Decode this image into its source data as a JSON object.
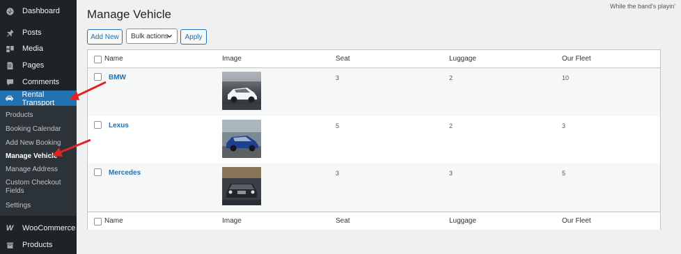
{
  "admin_bar": {
    "text": "While the band's playin'"
  },
  "sidebar": {
    "items": [
      {
        "label": "Dashboard",
        "icon": "dashboard-icon"
      },
      {
        "label": "Posts",
        "icon": "pin-icon"
      },
      {
        "label": "Media",
        "icon": "media-icon"
      },
      {
        "label": "Pages",
        "icon": "pages-icon"
      },
      {
        "label": "Comments",
        "icon": "comments-icon"
      },
      {
        "label": "Rental Transport",
        "icon": "car-icon"
      },
      {
        "label": "WooCommerce",
        "icon": "woocommerce-icon"
      },
      {
        "label": "Products",
        "icon": "products-icon"
      }
    ],
    "submenu": [
      {
        "label": "Products"
      },
      {
        "label": "Booking Calendar"
      },
      {
        "label": "Add New Booking"
      },
      {
        "label": "Manage Vehicle"
      },
      {
        "label": "Manage Address"
      },
      {
        "label": "Custom Checkout Fields"
      },
      {
        "label": "Settings"
      }
    ]
  },
  "main": {
    "title": "Manage Vehicle",
    "add_new_label": "Add New",
    "bulk_actions_label": "Bulk actions",
    "apply_label": "Apply"
  },
  "table": {
    "columns": [
      "Name",
      "Image",
      "Seat",
      "Luggage",
      "Our Fleet"
    ],
    "rows": [
      {
        "name": "BMW",
        "seat": "3",
        "luggage": "2",
        "fleet": "10",
        "image": "white-sedan-photo"
      },
      {
        "name": "Lexus",
        "seat": "5",
        "luggage": "2",
        "fleet": "3",
        "image": "blue-sedan-photo"
      },
      {
        "name": "Mercedes",
        "seat": "3",
        "luggage": "3",
        "fleet": "5",
        "image": "dark-car-photo"
      }
    ]
  },
  "colors": {
    "sidebar_bg": "#1d2327",
    "active_bg": "#2271b1",
    "link": "#2271b1",
    "arrow": "#e02424"
  }
}
